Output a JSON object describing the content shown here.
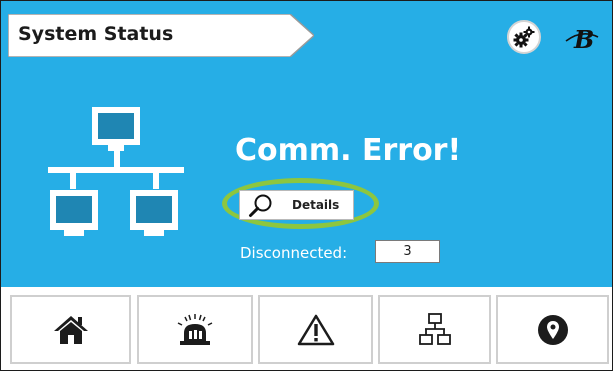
{
  "header": {
    "title": "System Status",
    "settings_icon": "gears-icon",
    "brand_icon": "brand-logo-icon"
  },
  "status": {
    "message": "Comm. Error!",
    "details_label": "Details",
    "disconnected_label": "Disconnected:",
    "disconnected_value": "3"
  },
  "nav": {
    "items": [
      {
        "name": "home",
        "icon": "home-icon"
      },
      {
        "name": "alarms",
        "icon": "alarm-light-icon"
      },
      {
        "name": "warnings",
        "icon": "warning-triangle-icon"
      },
      {
        "name": "network",
        "icon": "network-icon"
      },
      {
        "name": "location",
        "icon": "location-pin-icon"
      }
    ]
  },
  "colors": {
    "background": "#26aee6",
    "highlight_ring": "#8dc63f",
    "text_light": "#ffffff",
    "text_dark": "#1b1b1b"
  }
}
